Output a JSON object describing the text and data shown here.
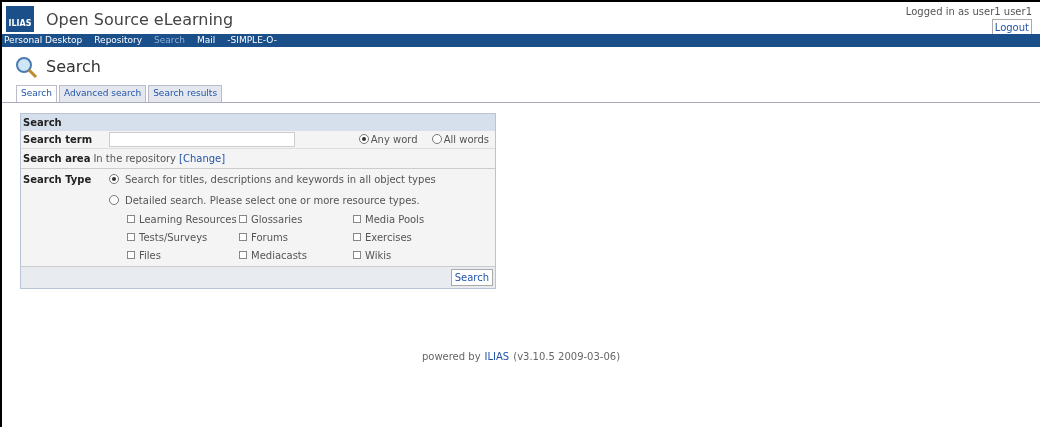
{
  "header": {
    "logo": "ILIAS",
    "title": "Open Source eLearning",
    "login_text": "Logged in as user1 user1",
    "logout": "Logout"
  },
  "nav": [
    {
      "label": "Personal Desktop",
      "selected": false
    },
    {
      "label": "Repository",
      "selected": false
    },
    {
      "label": "Search",
      "selected": true
    },
    {
      "label": "Mail",
      "selected": false
    },
    {
      "label": "-SIMPLE-O-",
      "selected": false
    }
  ],
  "page_title": "Search",
  "tabs": [
    {
      "label": "Search",
      "selected": true
    },
    {
      "label": "Advanced search",
      "selected": false
    },
    {
      "label": "Search results",
      "selected": false
    }
  ],
  "form": {
    "section_title": "Search",
    "search_term": {
      "label": "Search term",
      "match": [
        {
          "label": "Any word",
          "selected": true
        },
        {
          "label": "All words",
          "selected": false
        }
      ]
    },
    "search_area": {
      "label": "Search area",
      "value": "In the repository",
      "link": "[Change]"
    },
    "search_type": {
      "label": "Search Type",
      "options": [
        {
          "label": "Search for titles, descriptions and keywords in all object types",
          "selected": true
        },
        {
          "label": "Detailed search. Please select one or more resource types.",
          "selected": false
        }
      ],
      "resource_types": [
        {
          "label": "Learning Resources",
          "checked": false
        },
        {
          "label": "Glossaries",
          "checked": false
        },
        {
          "label": "Media Pools",
          "checked": false
        },
        {
          "label": "Tests/Surveys",
          "checked": false
        },
        {
          "label": "Forums",
          "checked": false
        },
        {
          "label": "Exercises",
          "checked": false
        },
        {
          "label": "Files",
          "checked": false
        },
        {
          "label": "Mediacasts",
          "checked": false
        },
        {
          "label": "Wikis",
          "checked": false
        }
      ]
    },
    "button": "Search"
  },
  "footer": {
    "prefix": "powered by",
    "link": "ILIAS",
    "version": "(v3.10.5 2009-03-06)"
  }
}
